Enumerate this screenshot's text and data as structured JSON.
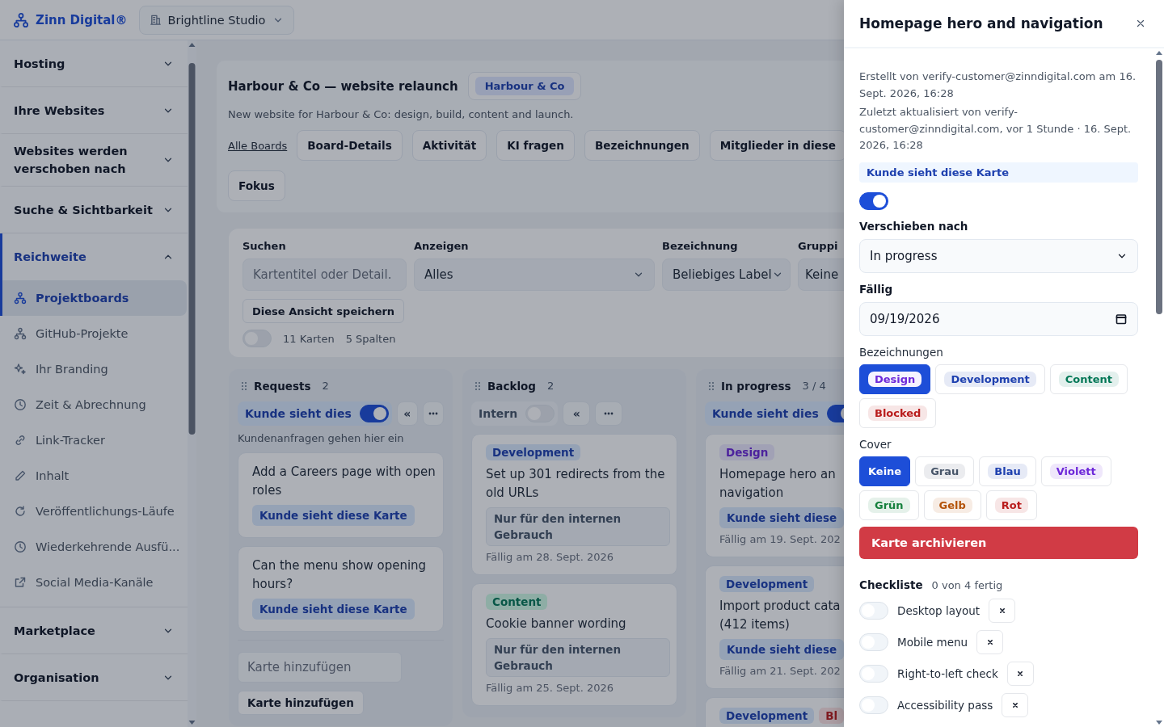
{
  "top_bar": {
    "brand": "Zinn Digital®",
    "workspace": "Brightline Studio"
  },
  "sidebar": {
    "sections": [
      {
        "title": "Hosting",
        "expanded": false
      },
      {
        "title": "Ihre Websites",
        "expanded": false
      },
      {
        "title": "Websites werden verschoben nach",
        "expanded": false
      },
      {
        "title": "Suche & Sichtbarkeit",
        "expanded": false
      },
      {
        "title": "Reichweite",
        "expanded": true,
        "items": [
          {
            "label": "Projektboards",
            "kind": "nodes",
            "selected": true
          },
          {
            "label": "GitHub-Projekte",
            "kind": "nodes",
            "selected": false
          },
          {
            "label": "Ihr Branding",
            "kind": "sparkles",
            "selected": false
          },
          {
            "label": "Zeit & Abrechnung",
            "kind": "clock",
            "selected": false
          },
          {
            "label": "Link-Tracker",
            "kind": "link",
            "selected": false
          },
          {
            "label": "Inhalt",
            "kind": "pencil",
            "selected": false
          },
          {
            "label": "Veröffentlichungs-Läufe",
            "kind": "refresh",
            "selected": false
          },
          {
            "label": "Wiederkehrende Ausfü...",
            "kind": "clock",
            "selected": false
          },
          {
            "label": "Social Media-Kanäle",
            "kind": "external",
            "selected": false
          }
        ]
      },
      {
        "title": "Marketplace",
        "expanded": false
      },
      {
        "title": "Organisation",
        "expanded": false
      }
    ]
  },
  "board": {
    "title": "Harbour & Co — website relaunch",
    "client": "Harbour & Co",
    "description": "New website for Harbour & Co: design, build, content and launch.",
    "nav": [
      {
        "label": "Alle Boards",
        "kind": "link"
      },
      {
        "label": "Board-Details",
        "kind": "button"
      },
      {
        "label": "Aktivität",
        "kind": "button"
      },
      {
        "label": "KI fragen",
        "kind": "button"
      },
      {
        "label": "Bezeichnungen",
        "kind": "button"
      },
      {
        "label": "Mitglieder in diese",
        "kind": "button"
      },
      {
        "label": "Fokus",
        "kind": "button"
      }
    ]
  },
  "filters": {
    "fields": [
      {
        "label": "Suchen",
        "kind": "text",
        "placeholder": "Kartentitel oder Detail."
      },
      {
        "label": "Anzeigen",
        "kind": "select",
        "value": "Alles"
      },
      {
        "label": "Bezeichnung",
        "kind": "select",
        "value": "Beliebiges Label"
      },
      {
        "label": "Gruppi",
        "kind": "cut",
        "value": "Keine"
      }
    ],
    "save_button": "Diese Ansicht speichern",
    "compact": {
      "on": false
    },
    "card_count": "11 Karten",
    "column_count": "5 Spalten"
  },
  "columns": [
    {
      "name": "Requests",
      "count": "2",
      "visibility": {
        "label": "Kunde sieht dies",
        "on": true
      },
      "collapse": "«",
      "description": "Kundenanfragen gehen hier ein",
      "cards": [
        {
          "title": "Add a Careers page with open roles",
          "note": {
            "kind": "client",
            "text": "Kunde sieht diese Karte"
          }
        },
        {
          "title": "Can the menu show opening hours?",
          "note": {
            "kind": "client",
            "text": "Kunde sieht diese Karte"
          }
        }
      ],
      "add": {
        "placeholder": "Karte hinzufügen",
        "button": "Karte hinzufügen"
      }
    },
    {
      "name": "Backlog",
      "count": "2",
      "visibility": {
        "label": "Intern",
        "on": false
      },
      "collapse": "«",
      "cards": [
        {
          "title": "Set up 301 redirects from the old URLs",
          "labels": [
            {
              "text": "Development",
              "kind": "development"
            }
          ],
          "note": {
            "kind": "internal",
            "text": "Nur für den internen Gebrauch"
          },
          "due": "Fällig am 28. Sept. 2026"
        },
        {
          "title": "Cookie banner wording",
          "labels": [
            {
              "text": "Content",
              "kind": "content"
            }
          ],
          "note": {
            "kind": "internal",
            "text": "Nur für den internen Gebrauch"
          },
          "due": "Fällig am 25. Sept. 2026"
        }
      ]
    },
    {
      "name": "In progress",
      "count": "3 / 4",
      "visibility": {
        "label": "Kunde sieht dies",
        "on": true
      },
      "cards": [
        {
          "title": "Homepage hero an navigation",
          "labels": [
            {
              "text": "Design",
              "kind": "design"
            }
          ],
          "note": {
            "kind": "client",
            "text": "Kunde sieht diese"
          },
          "due": "Fällig am 19. Sept. 202"
        },
        {
          "title": "Import product cata (412 items)",
          "labels": [
            {
              "text": "Development",
              "kind": "development"
            }
          ],
          "note": {
            "kind": "client",
            "text": "Kunde sieht diese"
          },
          "due": "Fällig am 21. Sept. 202"
        },
        {
          "labels": [
            {
              "text": "Development",
              "kind": "development"
            },
            {
              "text": "Bl",
              "kind": "blocked"
            }
          ]
        }
      ]
    }
  ],
  "drawer": {
    "title": "Homepage hero and navigation",
    "created": "Erstellt von verify-customer@zinndigital.com am 16. Sept. 2026, 16:28",
    "updated": "Zuletzt aktualisiert von verify-customer@zinndigital.com, vor 1 Stunde · 16. Sept. 2026, 16:28",
    "visibility": {
      "label": "Kunde sieht diese Karte",
      "on": true
    },
    "move": {
      "label": "Verschieben nach",
      "value": "In progress"
    },
    "due": {
      "label": "Fällig",
      "value": "09/19/2026"
    },
    "labels": {
      "title": "Bezeichnungen",
      "options": [
        {
          "text": "Design",
          "color": "#6d28d9",
          "selected": true
        },
        {
          "text": "Development",
          "color": "#1e40af",
          "selected": false
        },
        {
          "text": "Content",
          "color": "#047857",
          "selected": false
        },
        {
          "text": "Blocked",
          "color": "#b91c1c",
          "selected": false
        }
      ]
    },
    "cover": {
      "title": "Cover",
      "options": [
        {
          "text": "Keine",
          "selected": true
        },
        {
          "text": "Grau",
          "color": "#475569",
          "selected": false
        },
        {
          "text": "Blau",
          "color": "#1e40af",
          "selected": false
        },
        {
          "text": "Violett",
          "color": "#6d28d9",
          "selected": false
        },
        {
          "text": "Grün",
          "color": "#15803d",
          "selected": false
        },
        {
          "text": "Gelb",
          "color": "#b45309",
          "selected": false
        },
        {
          "text": "Rot",
          "color": "#b91c1c",
          "selected": false
        }
      ]
    },
    "archive_button": "Karte archivieren",
    "checklist": {
      "title": "Checkliste",
      "progress": "0 von 4 fertig",
      "items": [
        {
          "text": "Desktop layout",
          "done": false
        },
        {
          "text": "Mobile menu",
          "done": false
        },
        {
          "text": "Right-to-left check",
          "done": false
        },
        {
          "text": "Accessibility pass",
          "done": false
        }
      ]
    }
  }
}
